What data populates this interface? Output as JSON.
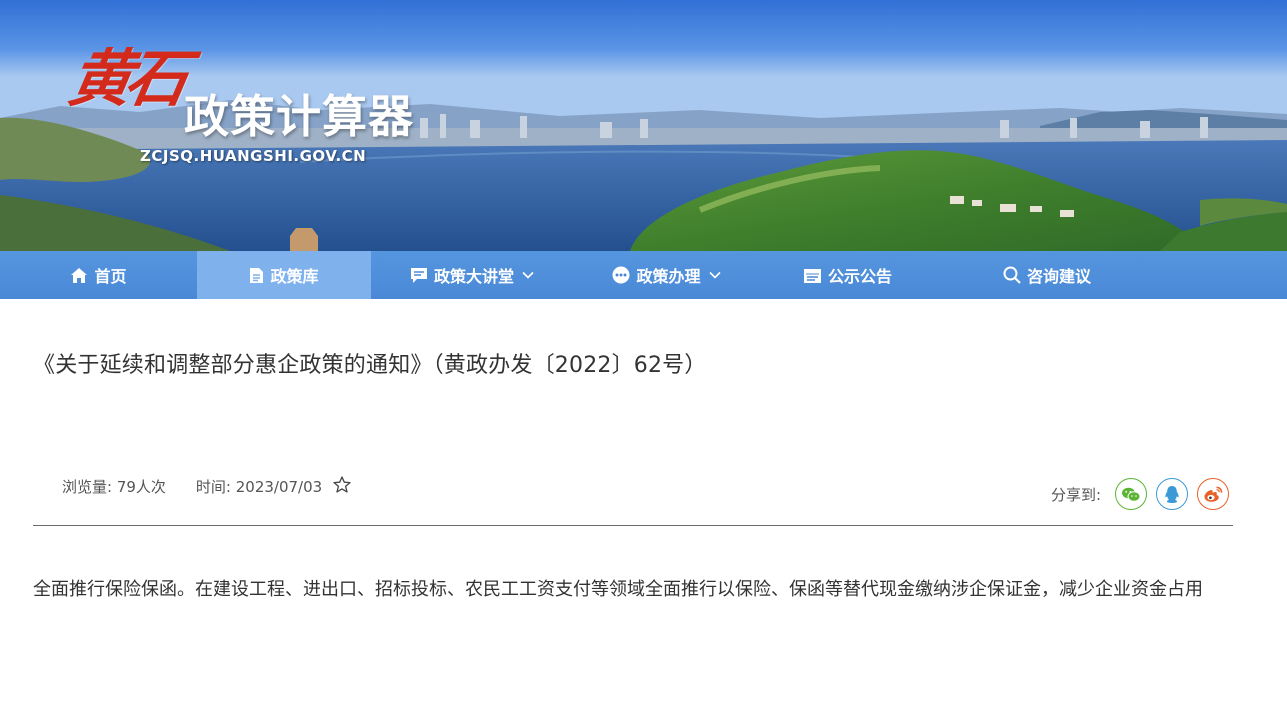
{
  "site": {
    "logo_calligraphy": "黄石",
    "logo_title": "政策计算器",
    "domain": "ZCJSQ.HUANGSHI.GOV.CN",
    "colors": {
      "nav": "#4a88d6",
      "nav_active": "#7fb1ec",
      "logo_red": "#d42a1c"
    }
  },
  "nav": {
    "items": [
      {
        "label": "首页",
        "icon": "home-icon"
      },
      {
        "label": "政策库",
        "icon": "document-icon",
        "active": true
      },
      {
        "label": "政策大讲堂",
        "icon": "chat-icon",
        "dropdown": true
      },
      {
        "label": "政策办理",
        "icon": "dots-bubble-icon",
        "dropdown": true
      },
      {
        "label": "公示公告",
        "icon": "calendar-icon"
      },
      {
        "label": "咨询建议",
        "icon": "search-icon"
      }
    ]
  },
  "article": {
    "title": "《关于延续和调整部分惠企政策的通知》（黄政办发〔2022〕62号）",
    "views_label": "浏览量: 79人次",
    "time_label": "时间: 2023/07/03",
    "share_label": "分享到:",
    "share_targets": [
      "wechat-icon",
      "qq-icon",
      "weibo-icon"
    ],
    "body": "全面推行保险保函。在建设工程、进出口、招标投标、农民工工资支付等领域全面推行以保险、保函等替代现金缴纳涉企保证金，减少企业资金占用"
  }
}
